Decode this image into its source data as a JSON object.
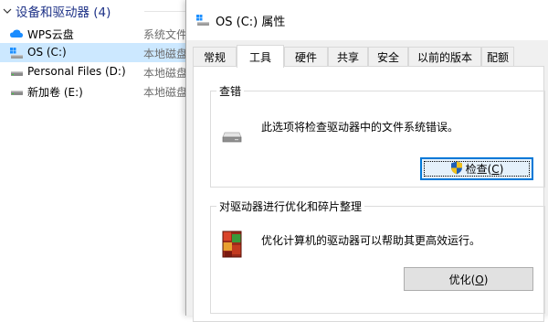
{
  "explorer": {
    "group_title": "设备和驱动器 (4)",
    "drives": [
      {
        "name": "WPS云盘",
        "type": "系统文件",
        "icon": "cloud-icon"
      },
      {
        "name": "OS (C:)",
        "type": "本地磁盘",
        "icon": "system-drive-icon",
        "selected": true
      },
      {
        "name": "Personal Files (D:)",
        "type": "本地磁盘",
        "icon": "drive-icon"
      },
      {
        "name": "新加卷 (E:)",
        "type": "本地磁盘",
        "icon": "drive-icon"
      }
    ]
  },
  "dialog": {
    "title": "OS (C:) 属性",
    "tabs": [
      "常规",
      "工具",
      "硬件",
      "共享",
      "安全",
      "以前的版本",
      "配额"
    ],
    "active_tab": "工具",
    "check_group": {
      "label": "查错",
      "description": "此选项将检查驱动器中的文件系统错误。",
      "button_text": "检查(",
      "button_key": "C",
      "button_suffix": ")"
    },
    "optimize_group": {
      "label": "对驱动器进行优化和碎片整理",
      "description": "优化计算机的驱动器可以帮助其更高效运行。",
      "button_text": "优化(",
      "button_key": "O",
      "button_suffix": ")"
    }
  },
  "colors": {
    "group_title": "#1e3287",
    "selection": "#cce8ff",
    "focus": "#0078d7"
  }
}
